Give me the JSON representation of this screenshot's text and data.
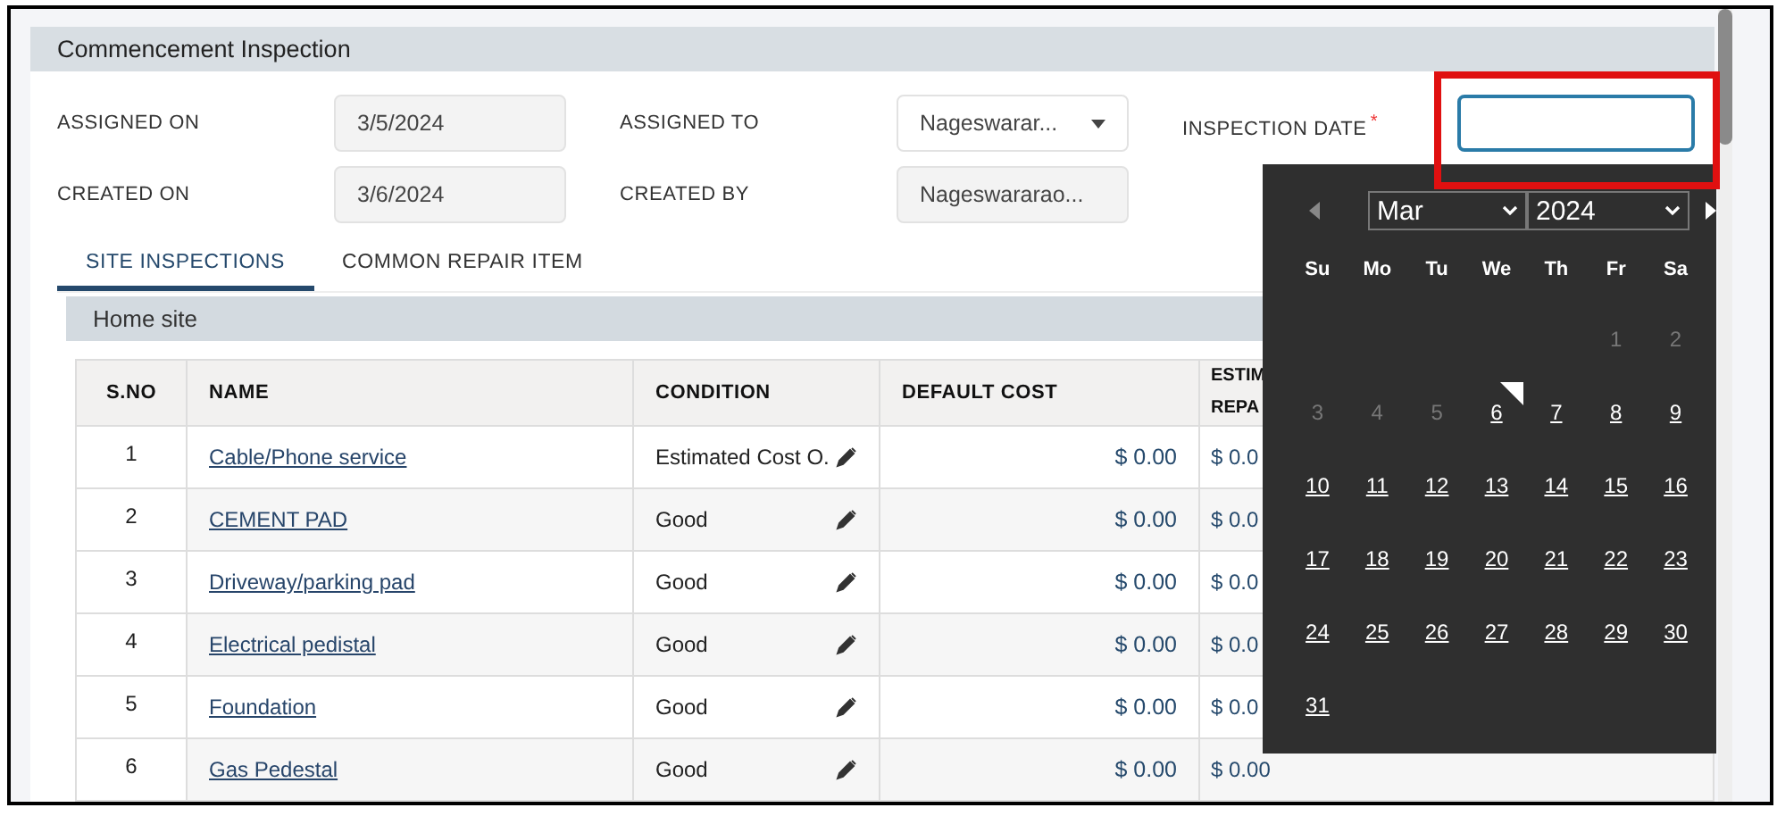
{
  "panel": {
    "title": "Commencement Inspection"
  },
  "fields": [
    {
      "label": "ASSIGNED ON",
      "kind": "readonly",
      "value": "3/5/2024"
    },
    {
      "label": "ASSIGNED TO",
      "kind": "dropdown",
      "value": "Nageswarar..."
    },
    {
      "label": "INSPECTION DATE",
      "kind": "input",
      "required_mark": "*",
      "focused": true
    },
    {
      "label": "CREATED ON",
      "kind": "readonly",
      "value": "3/6/2024"
    },
    {
      "label": "CREATED BY",
      "kind": "readonly",
      "value": "Nageswararao..."
    }
  ],
  "tabs": [
    {
      "label": "SITE INSPECTIONS",
      "selected": true
    },
    {
      "label": "COMMON REPAIR ITEM",
      "selected": false
    }
  ],
  "section": {
    "title": "Home site"
  },
  "table": {
    "columns": [
      "S.NO",
      "NAME",
      "CONDITION",
      "DEFAULT COST",
      "ESTIM REPA"
    ],
    "rows": [
      {
        "sno": "1",
        "name": "Cable/Phone service",
        "condition": "Estimated Cost O.",
        "default_cost": "$ 0.00",
        "column_5": "$ 0.0"
      },
      {
        "sno": "2",
        "name": "CEMENT PAD",
        "condition": "Good",
        "default_cost": "$ 0.00",
        "column_5": "$ 0.0"
      },
      {
        "sno": "3",
        "name": "Driveway/parking pad",
        "condition": "Good",
        "default_cost": "$ 0.00",
        "column_5": "$ 0.0"
      },
      {
        "sno": "4",
        "name": "Electrical pedistal",
        "condition": "Good",
        "default_cost": "$ 0.00",
        "column_5": "$ 0.0"
      },
      {
        "sno": "5",
        "name": "Foundation",
        "condition": "Good",
        "default_cost": "$ 0.00",
        "column_5": "$ 0.0"
      },
      {
        "sno": "6",
        "name": "Gas Pedestal",
        "condition": "Good",
        "default_cost": "$ 0.00",
        "column_5": "$ 0.00"
      }
    ]
  },
  "calendar": {
    "month": "Mar",
    "year": "2024",
    "weekdays": [
      "Su",
      "Mo",
      "Tu",
      "We",
      "Th",
      "Fr",
      "Sa"
    ],
    "weeks": [
      [
        {
          "day": "1",
          "disabled": true,
          "today": false
        },
        {
          "day": "2",
          "disabled": true,
          "today": false
        }
      ],
      [
        {
          "day": "3",
          "disabled": true,
          "today": false
        },
        {
          "day": "4",
          "disabled": true,
          "today": false
        },
        {
          "day": "5",
          "disabled": true,
          "today": false
        },
        {
          "day": "6",
          "disabled": false,
          "today": true
        },
        {
          "day": "7",
          "disabled": false,
          "today": false
        },
        {
          "day": "8",
          "disabled": false,
          "today": false
        },
        {
          "day": "9",
          "disabled": false,
          "today": false
        }
      ],
      [
        {
          "day": "10",
          "disabled": false,
          "today": false
        },
        {
          "day": "11",
          "disabled": false,
          "today": false
        },
        {
          "day": "12",
          "disabled": false,
          "today": false
        },
        {
          "day": "13",
          "disabled": false,
          "today": false
        },
        {
          "day": "14",
          "disabled": false,
          "today": false
        },
        {
          "day": "15",
          "disabled": false,
          "today": false
        },
        {
          "day": "16",
          "disabled": false,
          "today": false
        }
      ],
      [
        {
          "day": "17",
          "disabled": false,
          "today": false
        },
        {
          "day": "18",
          "disabled": false,
          "today": false
        },
        {
          "day": "19",
          "disabled": false,
          "today": false
        },
        {
          "day": "20",
          "disabled": false,
          "today": false
        },
        {
          "day": "21",
          "disabled": false,
          "today": false
        },
        {
          "day": "22",
          "disabled": false,
          "today": false
        },
        {
          "day": "23",
          "disabled": false,
          "today": false
        }
      ],
      [
        {
          "day": "24",
          "disabled": false,
          "today": false
        },
        {
          "day": "25",
          "disabled": false,
          "today": false
        },
        {
          "day": "26",
          "disabled": false,
          "today": false
        },
        {
          "day": "27",
          "disabled": false,
          "today": false
        },
        {
          "day": "28",
          "disabled": false,
          "today": false
        },
        {
          "day": "29",
          "disabled": false,
          "today": false
        },
        {
          "day": "30",
          "disabled": false,
          "today": false
        }
      ],
      [
        {
          "day": "31",
          "disabled": false,
          "today": false
        }
      ]
    ]
  }
}
